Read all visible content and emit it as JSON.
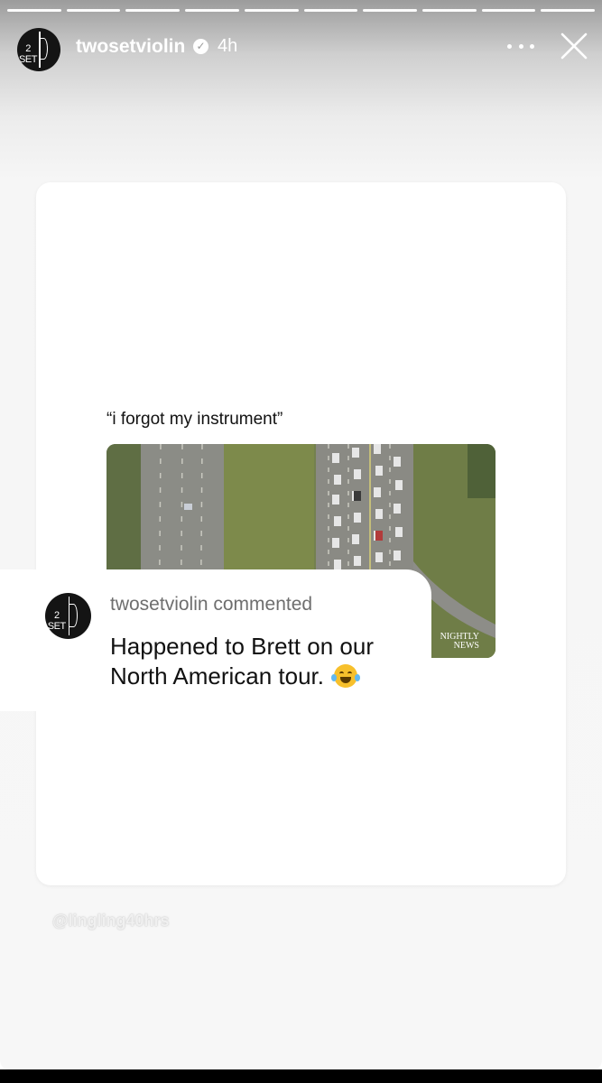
{
  "story": {
    "segments": 10,
    "username": "twosetviolin",
    "verified_icon": "verified-badge-icon",
    "time": "4h",
    "avatar_text": "2 SET"
  },
  "post": {
    "caption": "“i forgot my instrument”",
    "video_watermark_line1": "NIGHTLY",
    "video_watermark_line2": "NEWS"
  },
  "comment": {
    "avatar_text": "2 SET",
    "header": "twosetviolin commented",
    "body": "Happened to Brett on our North American tour.",
    "emoji": "face-with-tears-of-joy-icon"
  },
  "mention": "@lingling40hrs",
  "colors": {
    "card": "#ffffff",
    "background": "#f7f7f7",
    "accent_emoji": "#f7c02c"
  }
}
